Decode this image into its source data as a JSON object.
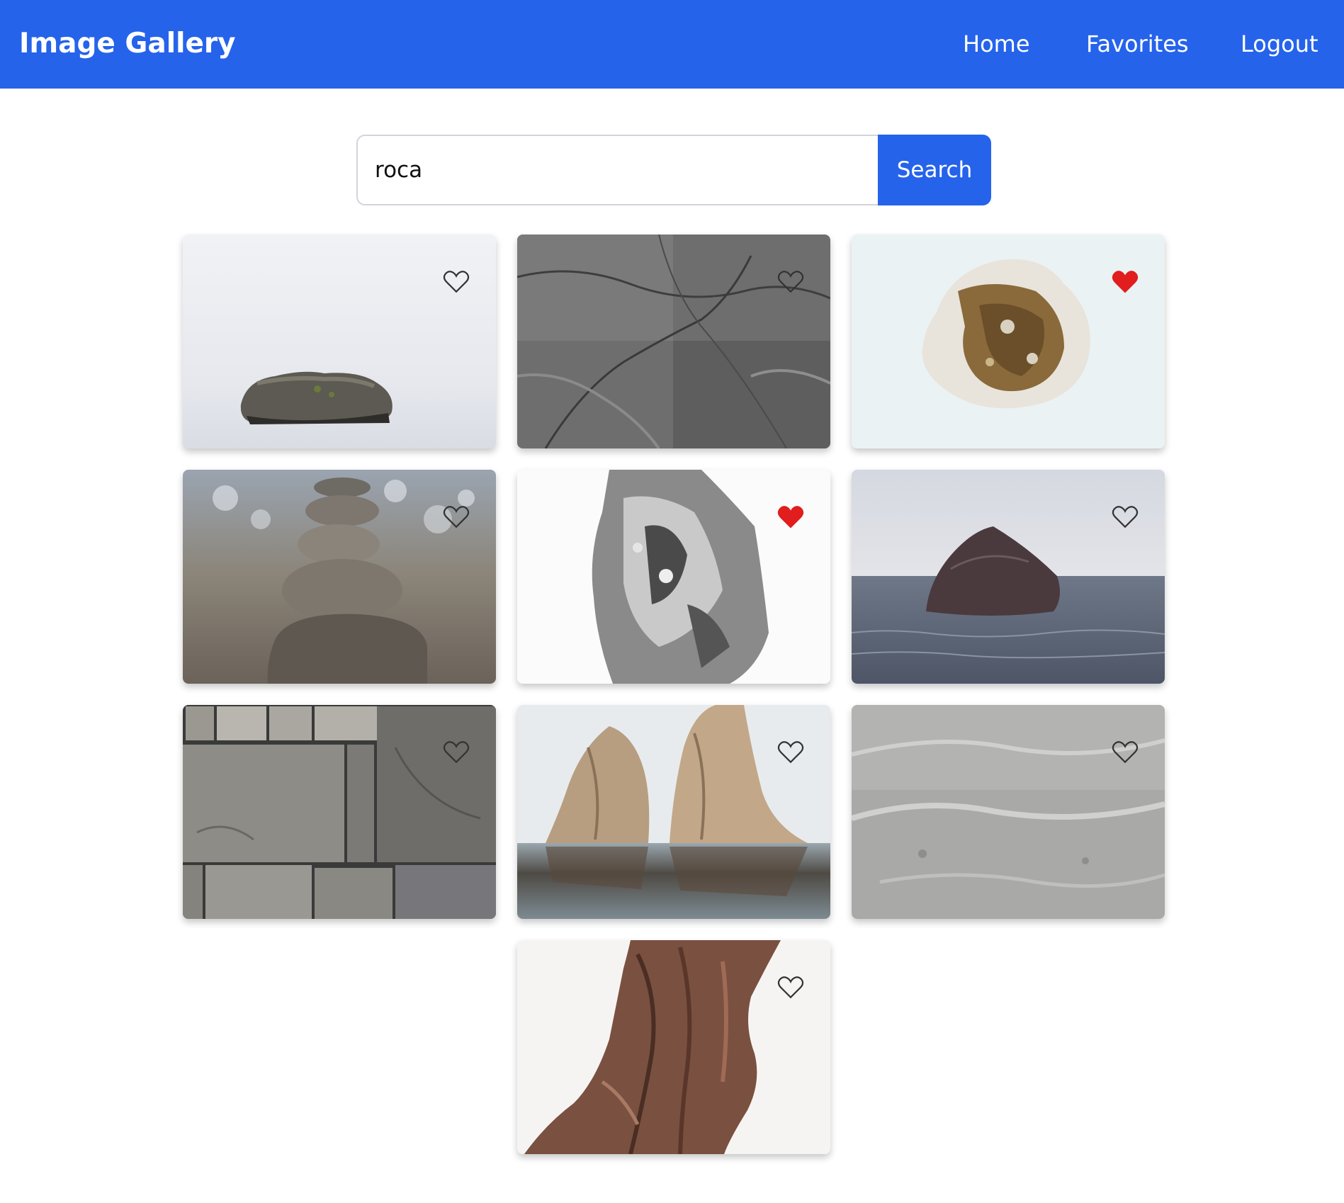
{
  "app": {
    "title": "Image Gallery"
  },
  "nav": {
    "items": [
      {
        "label": "Home"
      },
      {
        "label": "Favorites"
      },
      {
        "label": "Logout"
      }
    ]
  },
  "search": {
    "value": "roca",
    "button_label": "Search"
  },
  "colors": {
    "primary": "#2563eb",
    "favorite": "#e11d1d",
    "unfavorite_outline": "#333333"
  },
  "gallery": {
    "images": [
      {
        "subject": "rock-in-mist",
        "favorited": false
      },
      {
        "subject": "gray-rock-texture",
        "favorited": false
      },
      {
        "subject": "white-brown-pebble",
        "favorited": true
      },
      {
        "subject": "stacked-stones",
        "favorited": false
      },
      {
        "subject": "silver-crystal-rock",
        "favorited": true
      },
      {
        "subject": "rock-in-sea",
        "favorited": false
      },
      {
        "subject": "stone-wall",
        "favorited": false
      },
      {
        "subject": "sea-stacks",
        "favorited": false
      },
      {
        "subject": "gray-stone-surface",
        "favorited": false
      },
      {
        "subject": "brown-rock-pillar",
        "favorited": false
      }
    ]
  }
}
